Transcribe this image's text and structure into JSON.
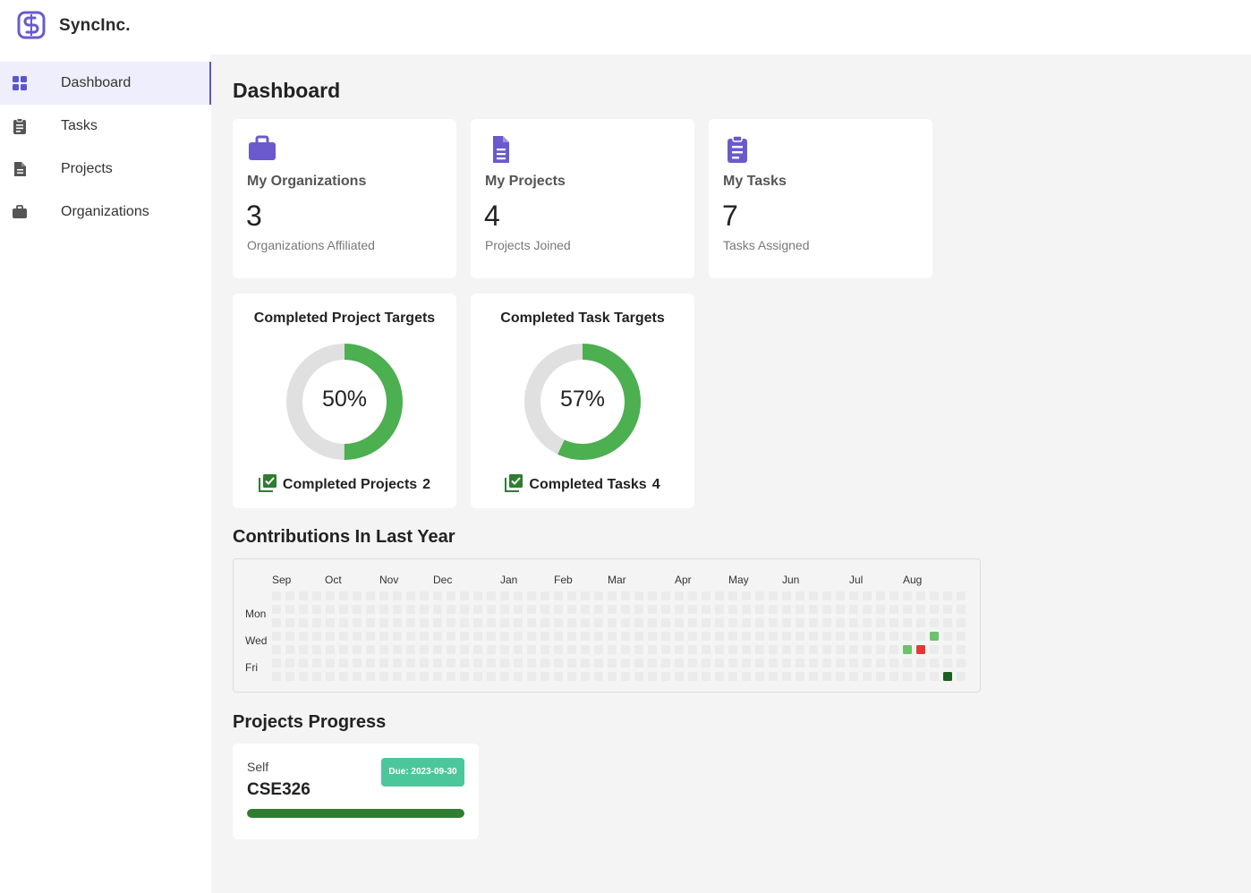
{
  "app": {
    "brand": "SyncInc."
  },
  "sidebar": {
    "items": [
      {
        "label": "Dashboard",
        "icon": "dashboard-icon",
        "active": true
      },
      {
        "label": "Tasks",
        "icon": "clipboard-icon"
      },
      {
        "label": "Projects",
        "icon": "document-icon"
      },
      {
        "label": "Organizations",
        "icon": "briefcase-icon"
      }
    ]
  },
  "main": {
    "title": "Dashboard",
    "stats": [
      {
        "icon": "briefcase-icon",
        "title": "My Organizations",
        "value": "3",
        "subtitle": "Organizations Affiliated"
      },
      {
        "icon": "document-icon",
        "title": "My Projects",
        "value": "4",
        "subtitle": "Projects Joined"
      },
      {
        "icon": "clipboard-icon",
        "title": "My Tasks",
        "value": "7",
        "subtitle": "Tasks Assigned"
      }
    ],
    "targets": [
      {
        "title": "Completed Project Targets",
        "percent": 50,
        "percent_label": "50%",
        "footer_label": "Completed Projects",
        "footer_count": "2"
      },
      {
        "title": "Completed Task Targets",
        "percent": 57,
        "percent_label": "57%",
        "footer_label": "Completed Tasks",
        "footer_count": "4"
      }
    ],
    "contributions": {
      "title": "Contributions In Last Year",
      "months": [
        "Sep",
        "Oct",
        "Nov",
        "Dec",
        "Jan",
        "Feb",
        "Mar",
        "Apr",
        "May",
        "Jun",
        "Jul",
        "Aug"
      ],
      "days": [
        "Mon",
        "Wed",
        "Fri"
      ],
      "weeks": 52,
      "active_cells": [
        {
          "week": 47,
          "day": 4,
          "color": "#6cc36a"
        },
        {
          "week": 48,
          "day": 4,
          "color": "#e53935"
        },
        {
          "week": 49,
          "day": 3,
          "color": "#6cc36a"
        },
        {
          "week": 50,
          "day": 6,
          "color": "#1b5e20"
        }
      ]
    },
    "projects_progress": {
      "title": "Projects Progress",
      "items": [
        {
          "owner": "Self",
          "name": "CSE326",
          "due": "Due: 2023-09-30",
          "progress": 1.0
        }
      ]
    }
  },
  "colors": {
    "accent": "#6a5acd",
    "ring_complete": "#4caf50",
    "ring_track": "#e0e0e0",
    "heat_empty": "#ebebeb",
    "badge": "#4cc79c",
    "progress": "#2e7d32"
  }
}
